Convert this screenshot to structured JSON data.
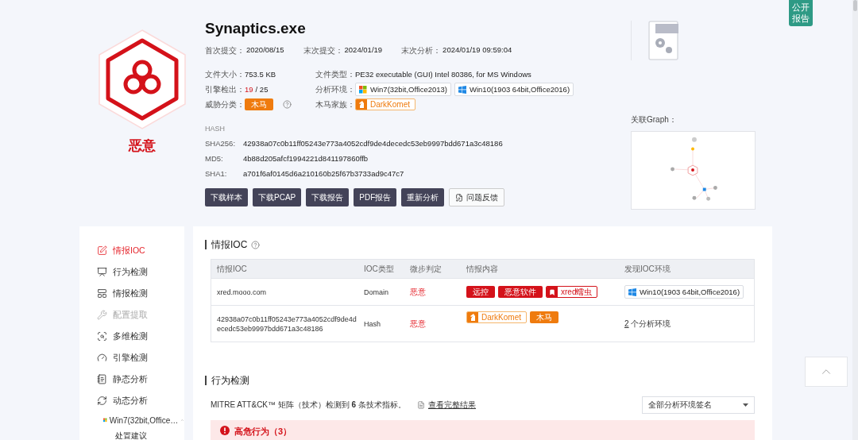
{
  "public_badge": "公开报告",
  "file": {
    "name": "Synaptics.exe",
    "verdict": "恶意"
  },
  "dates": [
    {
      "label": "首次提交：",
      "value": "2020/08/15"
    },
    {
      "label": "末次提交：",
      "value": "2024/01/19"
    },
    {
      "label": "末次分析：",
      "value": "2024/01/19 09:59:04"
    }
  ],
  "size": {
    "label": "文件大小：",
    "value": "753.5 KB"
  },
  "detection": {
    "label": "引擎检出：",
    "hits": "19",
    "total": "/ 25"
  },
  "threat": {
    "label": "威胁分类：",
    "tag": "木马"
  },
  "file_type": {
    "label": "文件类型：",
    "value": "PE32 executable (GUI) Intel 80386, for MS Windows"
  },
  "environments": {
    "label": "分析环境：",
    "items": [
      {
        "kind": "win7",
        "label": "Win7(32bit,Office2013)"
      },
      {
        "kind": "win10",
        "label": "Win10(1903 64bit,Office2016)"
      }
    ]
  },
  "family": {
    "label": "木马家族：",
    "tag": "DarkKomet"
  },
  "hash": {
    "title": "HASH",
    "rows": [
      {
        "label": "SHA256:",
        "value": "42938a07c0b11ff05243e773a4052cdf9de4decedc53eb9997bdd671a3c48186"
      },
      {
        "label": "MD5:",
        "value": "4b88d205afcf1994221d841197860ffb"
      },
      {
        "label": "SHA1:",
        "value": "a701f6af0145d6a210160b25f67b3733ad9c47c7"
      }
    ]
  },
  "actions": [
    {
      "kind": "dark",
      "label": "下载样本"
    },
    {
      "kind": "dark",
      "label": "下载PCAP"
    },
    {
      "kind": "dark",
      "label": "下载报告"
    },
    {
      "kind": "dark",
      "label": "PDF报告"
    },
    {
      "kind": "dark",
      "label": "重新分析"
    },
    {
      "kind": "outline",
      "label": "问题反馈"
    }
  ],
  "graph_label": "关联Graph：",
  "sidebar": {
    "items": [
      {
        "label": "情报IOC",
        "selected": true,
        "disabled": false
      },
      {
        "label": "行为检测",
        "selected": false,
        "disabled": false
      },
      {
        "label": "情报检测",
        "selected": false,
        "disabled": false
      },
      {
        "label": "配置提取",
        "selected": false,
        "disabled": true
      },
      {
        "label": "多维检测",
        "selected": false,
        "disabled": false
      },
      {
        "label": "引擎检测",
        "selected": false,
        "disabled": false
      },
      {
        "label": "静态分析",
        "selected": false,
        "disabled": false
      },
      {
        "label": "动态分析",
        "selected": false,
        "disabled": false,
        "children": [
          {
            "label": "Win7(32bit,Office…",
            "expanded": true,
            "children": [
              {
                "label": "处置建议"
              }
            ]
          }
        ]
      }
    ]
  },
  "ioc": {
    "title": "情报IOC",
    "columns": [
      "情报IOC",
      "IOC类型",
      "微步判定",
      "情报内容",
      "发现IOC环境"
    ],
    "rows": [
      {
        "ioc": "xred.mooo.com",
        "type": "Domain",
        "verdict": "恶意",
        "tags": [
          {
            "kind": "solid-red",
            "label": "远控"
          },
          {
            "kind": "solid-red",
            "label": "恶意软件"
          },
          {
            "kind": "outline-red",
            "label": "xred蠕虫"
          }
        ],
        "env": {
          "kind": "win10",
          "label": "Win10(1903 64bit,Office2016)"
        }
      },
      {
        "ioc": "42938a07c0b11ff05243e773a4052cdf9de4decedc53eb9997bdd671a3c48186",
        "type": "Hash",
        "verdict": "恶意",
        "tags": [
          {
            "kind": "outline-orange",
            "label": "DarkKomet"
          },
          {
            "kind": "solid-orange",
            "label": "木马"
          }
        ],
        "env": {
          "kind": "count",
          "count": "2",
          "label": "个分析环境"
        }
      }
    ]
  },
  "behavior": {
    "title": "行为检测",
    "summary": "MITRE ATT&CK™ 矩阵（技术）检测到 **6** 条技术指标。",
    "link": "查看完整结果",
    "filter": "全部分析环境签名",
    "alert": "高危行为（3）"
  }
}
